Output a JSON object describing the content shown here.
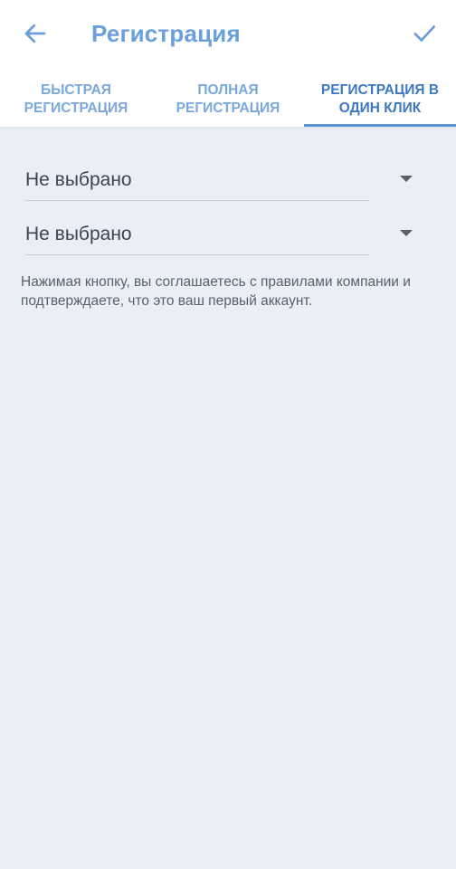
{
  "header": {
    "title": "Регистрация"
  },
  "tabs": [
    {
      "label": "Быстрая регистрация",
      "active": false
    },
    {
      "label": "Полная регистрация",
      "active": false
    },
    {
      "label": "Регистрация в один клик",
      "active": true
    }
  ],
  "form": {
    "select_1": {
      "value": "Не выбрано"
    },
    "select_2": {
      "value": "Не выбрано"
    },
    "notice": "Нажимая кнопку, вы соглашаетесь с правилами компании и подтверждаете, что это ваш первый аккаунт."
  },
  "icons": {
    "back": "arrow-left-icon",
    "confirm": "check-icon"
  },
  "colors": {
    "accent": "#6a9fdc",
    "active_tab": "#3f78c2",
    "indicator": "#5a94d6",
    "background": "#e9eef7"
  }
}
